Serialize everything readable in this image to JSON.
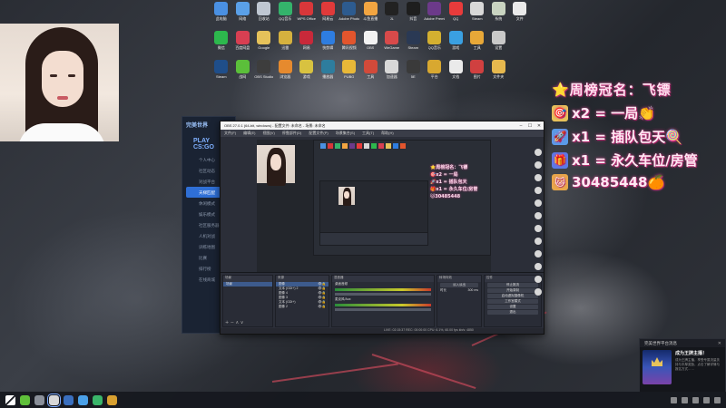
{
  "desktop": {
    "icon_rows": [
      [
        {
          "label": "此电脑",
          "color": "#4a90e2"
        },
        {
          "label": "网络",
          "color": "#5aa0e8"
        },
        {
          "label": "回收站",
          "color": "#bfc7d2"
        },
        {
          "label": "QQ音乐",
          "color": "#34b36b"
        },
        {
          "label": "WPS Office",
          "color": "#d8373a"
        },
        {
          "label": "网易云",
          "color": "#e03a3a"
        },
        {
          "label": "Adobe Photoshop",
          "color": "#2d5b8f"
        },
        {
          "label": "斗鱼直播",
          "color": "#f2a541"
        },
        {
          "label": "JL",
          "color": "#222"
        },
        {
          "label": "抖音",
          "color": "#1e1e1e"
        },
        {
          "label": "Adobe Premiere",
          "color": "#6c3a8a"
        },
        {
          "label": "QQ",
          "color": "#e83b3b"
        },
        {
          "label": "Steam",
          "color": "#d8d8d8"
        },
        {
          "label": "系统",
          "color": "#c9d4c1"
        },
        {
          "label": "文件",
          "color": "#eaeaea"
        }
      ],
      [
        {
          "label": "微信",
          "color": "#2db84d"
        },
        {
          "label": "百度网盘",
          "color": "#d83f52"
        },
        {
          "label": "Google",
          "color": "#e6c25a"
        },
        {
          "label": "迅雷",
          "color": "#d5b13e"
        },
        {
          "label": "网易",
          "color": "#c8293a"
        },
        {
          "label": "快剪辑",
          "color": "#2e7de0"
        },
        {
          "label": "腾讯视频",
          "color": "#e2552d"
        },
        {
          "label": "OBS",
          "color": "#f2f2f2"
        },
        {
          "label": "WeGame",
          "color": "#d84a4a"
        },
        {
          "label": "Steam",
          "color": "#2a3954"
        },
        {
          "label": "QQ音乐",
          "color": "#d4b030"
        },
        {
          "label": "游戏",
          "color": "#3aa0e2"
        },
        {
          "label": "工具",
          "color": "#e8a838"
        },
        {
          "label": "设置",
          "color": "#c9c9c9"
        }
      ],
      [
        {
          "label": "Steam",
          "color": "#1f4e8a"
        },
        {
          "label": "战网",
          "color": "#5bbf3a"
        },
        {
          "label": "OBS Studio",
          "color": "#3d3d3d"
        },
        {
          "label": "浏览器",
          "color": "#e68a2e"
        },
        {
          "label": "游戏",
          "color": "#d8c240"
        },
        {
          "label": "播放器",
          "color": "#2e7d9e"
        },
        {
          "label": "PUBG",
          "color": "#e8b838"
        },
        {
          "label": "工具",
          "color": "#d24a3a"
        },
        {
          "label": "加速器",
          "color": "#d8d8d8"
        },
        {
          "label": "5E",
          "color": "#3a3a3a"
        },
        {
          "label": "平台",
          "color": "#d8a830"
        },
        {
          "label": "文档",
          "color": "#eaeaea"
        },
        {
          "label": "图片",
          "color": "#d04040"
        },
        {
          "label": "文件夹",
          "color": "#e6b84e"
        }
      ]
    ]
  },
  "overlay": {
    "title": "⭐周榜冠名：飞镖",
    "lines": [
      {
        "icon": "🎯",
        "icon_bg": "#e8c35a",
        "text": "x2 = 一局👏"
      },
      {
        "icon": "🚀",
        "icon_bg": "#5a9ae8",
        "text": "x1 = 插队包天🍭"
      },
      {
        "icon": "🎁",
        "icon_bg": "#5a7ae8",
        "text": "x1 = 永久车位/房管"
      },
      {
        "icon": "🐱",
        "icon_bg": "#e8a84a",
        "text": "30485448🍊"
      }
    ]
  },
  "game_client": {
    "logo": "完美世界",
    "heading": "PLAY CS:GO",
    "nav": [
      {
        "label": "个人中心",
        "active": false
      },
      {
        "label": "社区动态",
        "active": false
      },
      {
        "label": "对战平台",
        "active": false
      },
      {
        "label": "天梯匹配",
        "active": true
      },
      {
        "label": "休闲模式",
        "active": false
      },
      {
        "label": "娱乐模式",
        "active": false
      },
      {
        "label": "社区服务器",
        "active": false
      },
      {
        "label": "人机对战",
        "active": false
      },
      {
        "label": "训练地图",
        "active": false
      },
      {
        "label": "比赛",
        "active": false
      },
      {
        "label": "排行榜",
        "active": false
      },
      {
        "label": "在线商城",
        "active": false
      }
    ]
  },
  "obs": {
    "title": "OBS 27.0.1 (64-bit, windows) - 配置文件: 未命名 - 场景: 未命名",
    "menu": [
      "文件(F)",
      "编辑(E)",
      "视图(V)",
      "停靠部件(D)",
      "配置文件(P)",
      "场景集合(S)",
      "工具(T)",
      "帮助(H)"
    ],
    "docks": {
      "scenes_header": "场景",
      "sources_header": "来源",
      "sources": [
        "图像",
        "文本 (GDI+) 2",
        "图像 4",
        "图像 3",
        "文本 (GDI+)",
        "图像 2"
      ],
      "mixer_header": "混音器",
      "mixer": [
        "桌面音频",
        "麦克风/Aux"
      ],
      "transition_header": "转场特效",
      "transition": "淡入淡出",
      "duration_label": "时长",
      "duration": "300 ms",
      "controls_header": "控件",
      "controls": [
        "停止推流",
        "开始录制",
        "启动虚拟摄像机",
        "工作室模式",
        "设置",
        "退出"
      ]
    },
    "status": "LIVE: 02:15:37   REC: 00:00:00   CPU: 6.1%, 60.00 fps   kb/s: 4850"
  },
  "notification": {
    "header": "完美世界平台消息",
    "close": "✕",
    "title": "成为王牌主播！",
    "desc": "成为王牌主播，享受专属流量扶持与丰厚奖励，点击了解详情与报名方式……"
  },
  "taskbar": {
    "apps": [
      {
        "name": "start",
        "color": "#e8e8e8",
        "active": false
      },
      {
        "name": "browser",
        "color": "#5fbf3a",
        "active": false
      },
      {
        "name": "wechat",
        "color": "#8a8f99",
        "active": false
      },
      {
        "name": "obs",
        "color": "#d8d8d8",
        "active": true
      },
      {
        "name": "steam",
        "color": "#3a6fbf",
        "active": false
      },
      {
        "name": "qq",
        "color": "#4aa0e8",
        "active": false
      },
      {
        "name": "music",
        "color": "#3ab56a",
        "active": false
      },
      {
        "name": "game",
        "color": "#d8a030",
        "active": false
      }
    ]
  }
}
